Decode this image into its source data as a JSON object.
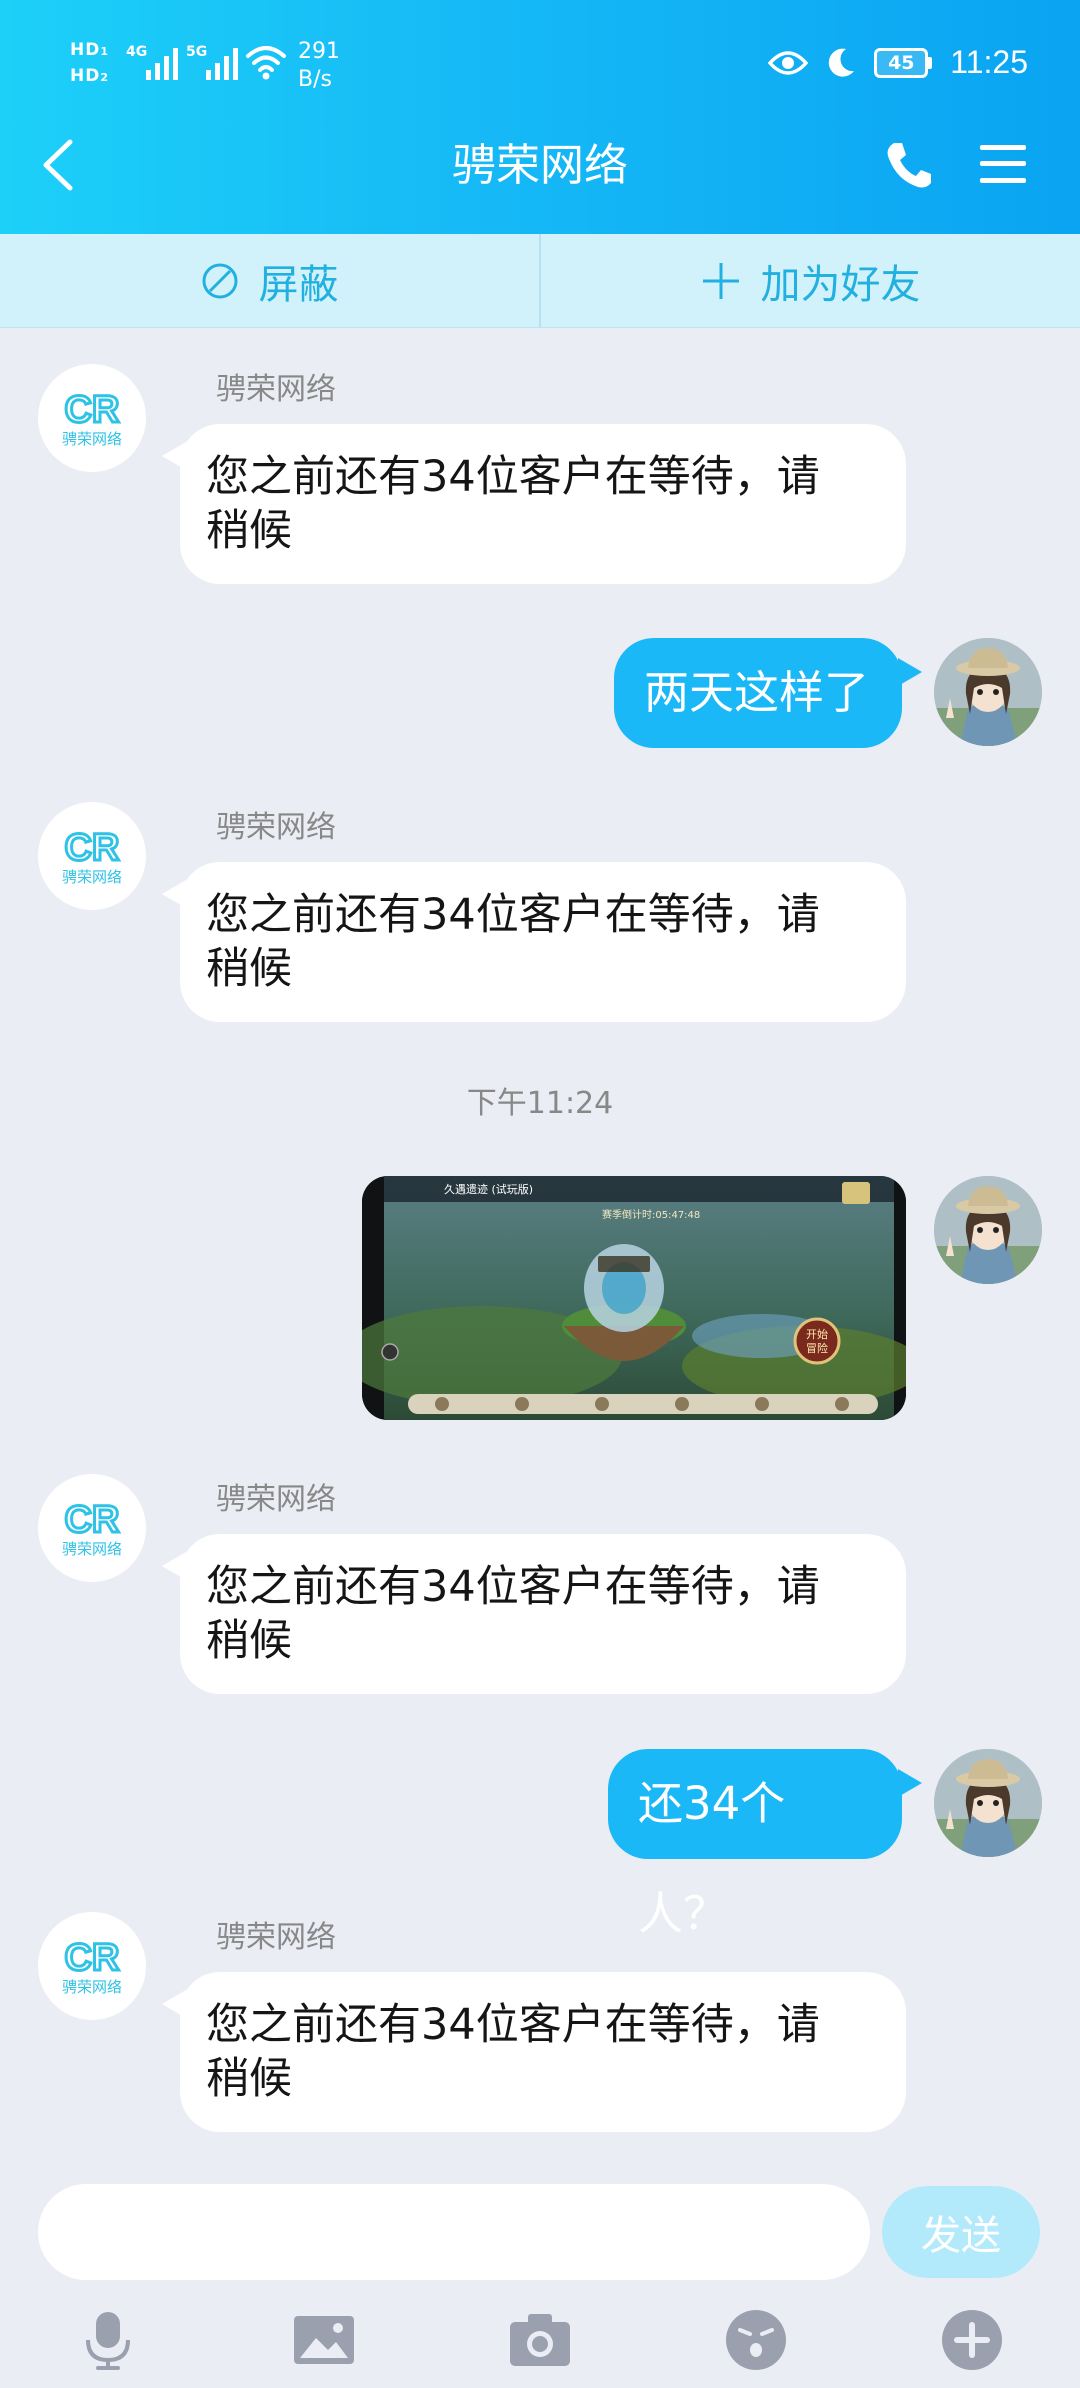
{
  "status_bar": {
    "hd1": "HD",
    "hd1_sub": "1",
    "hd2": "HD",
    "hd2_sub": "2",
    "net1": "4G",
    "net2": "5G",
    "speed_value": "291",
    "speed_unit": "B/s",
    "battery": "45",
    "time": "11:25"
  },
  "header": {
    "title": "骋荣网络",
    "icons": [
      "back-icon",
      "phone-icon",
      "menu-icon"
    ]
  },
  "actions": {
    "block_label": "屏蔽",
    "add_friend_label": "加为好友"
  },
  "messages": [
    {
      "sender": "骋荣网络",
      "text_line1": "您之前还有34位客户在等待，请",
      "text_line2": "稍候"
    },
    {
      "text": "两天这样了"
    },
    {
      "sender": "骋荣网络",
      "text_line1": "您之前还有34位客户在等待，请",
      "text_line2": "稍候"
    },
    {
      "timestamp": "下午11:24"
    },
    {
      "type": "image",
      "text_title": "久遇遗迹 (试玩版)",
      "text_timer": "赛季倒计时:05:47:48",
      "text_start_1": "开始",
      "text_start_2": "冒险"
    },
    {
      "sender": "骋荣网络",
      "text_line1": "您之前还有34位客户在等待，请",
      "text_line2": "稍候"
    },
    {
      "text": "还34个人？"
    },
    {
      "sender": "骋荣网络",
      "text_line1": "您之前还有34位客户在等待，请",
      "text_line2": "稍候"
    }
  ],
  "input": {
    "value": "",
    "send_label": "发送"
  },
  "toolbar_icons": [
    "microphone-icon",
    "image-icon",
    "camera-icon",
    "emoji-icon",
    "plus-icon"
  ],
  "colors": {
    "header_start": "#1cd0f8",
    "header_end": "#0aa4f2",
    "outgoing_bubble": "#1ab8f7",
    "chat_bg": "#eaedf4",
    "action_bar_bg": "#d2f2fb",
    "action_text": "#22b0e0",
    "send_button": "#b3eafb"
  }
}
